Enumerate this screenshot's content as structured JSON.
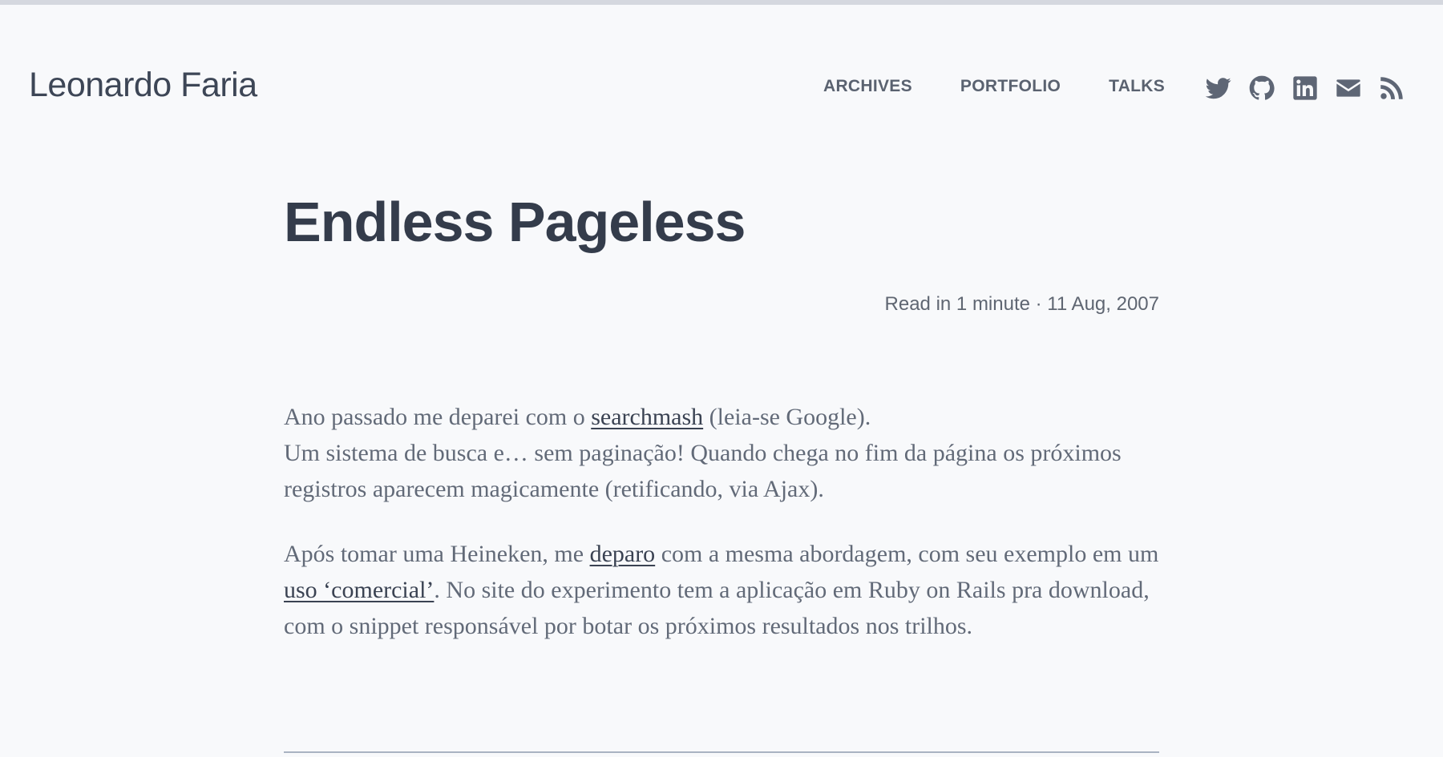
{
  "site": {
    "title": "Leonardo Faria"
  },
  "nav": {
    "items": [
      {
        "label": "ARCHIVES"
      },
      {
        "label": "PORTFOLIO"
      },
      {
        "label": "TALKS"
      }
    ]
  },
  "social": {
    "icons": [
      "twitter-icon",
      "github-icon",
      "linkedin-icon",
      "email-icon",
      "rss-icon"
    ],
    "color": "#5e6675"
  },
  "post": {
    "title": "Endless Pageless",
    "meta": "Read in 1 minute · 11 Aug, 2007",
    "p1": {
      "t1": "Ano passado me deparei com o ",
      "link1": "searchmash",
      "t2": " (leia-se Google).",
      "t3": "Um sistema de busca e… sem paginação! Quando chega no fim da página os próximos registros aparecem magicamente (retificando, via Ajax)."
    },
    "p2": {
      "t1": "Após tomar uma Heineken, me ",
      "link1": "deparo",
      "t2": " com a mesma abordagem, com seu exemplo em um ",
      "link2": "uso ‘comercial’",
      "t3": ". No site do experimento tem a aplicação em Ruby on Rails pra download, com o snippet responsável por botar os próximos resultados nos trilhos."
    }
  },
  "colors": {
    "background": "#f8f9fb",
    "text": "#626a78",
    "heading": "#343c4b"
  }
}
